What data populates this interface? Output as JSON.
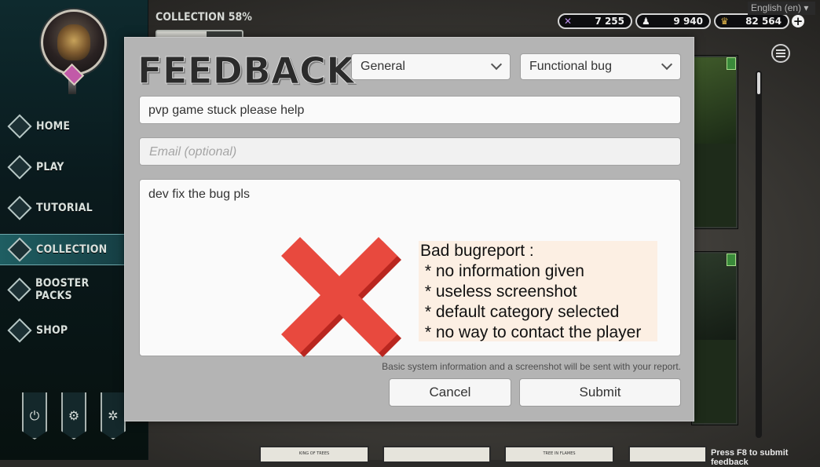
{
  "language": {
    "label": "English (en) ▾"
  },
  "sidebar": {
    "items": [
      {
        "label": "HOME"
      },
      {
        "label": "PLAY"
      },
      {
        "label": "TUTORIAL"
      },
      {
        "label": "COLLECTION"
      },
      {
        "label": "BOOSTER PACKS"
      },
      {
        "label": "SHOP"
      }
    ],
    "active_index": 3
  },
  "topbar": {
    "collection_label": "COLLECTION 58%",
    "collection_progress": 0.58,
    "currencies": [
      {
        "icon": "crossed-swords-icon",
        "value": "7 255"
      },
      {
        "icon": "hooded-figure-icon",
        "value": "9 940"
      },
      {
        "icon": "crown-icon",
        "value": "82 564"
      }
    ],
    "plus_label": "+"
  },
  "modal": {
    "title": "FEEDBACK",
    "category_select": {
      "value": "General"
    },
    "type_select": {
      "value": "Functional bug"
    },
    "subject_value": "pvp game stuck please help",
    "email_placeholder": "Email (optional)",
    "body_value": "dev fix the bug pls",
    "info_text": "Basic system information and a screenshot will be sent with your report.",
    "cancel_label": "Cancel",
    "submit_label": "Submit"
  },
  "annotation": {
    "cross_color": "#e8493e",
    "lines": [
      "Bad bugreport :",
      " * no information given",
      " * useless screenshot",
      " * default category selected",
      " * no way to contact the player"
    ]
  },
  "bottom_cards": [
    {
      "label": "KING OF TREES"
    },
    {
      "label": ""
    },
    {
      "label": "TREE IN FLAMES"
    },
    {
      "label": ""
    }
  ],
  "footer_hint": "Press F8 to submit feedback"
}
